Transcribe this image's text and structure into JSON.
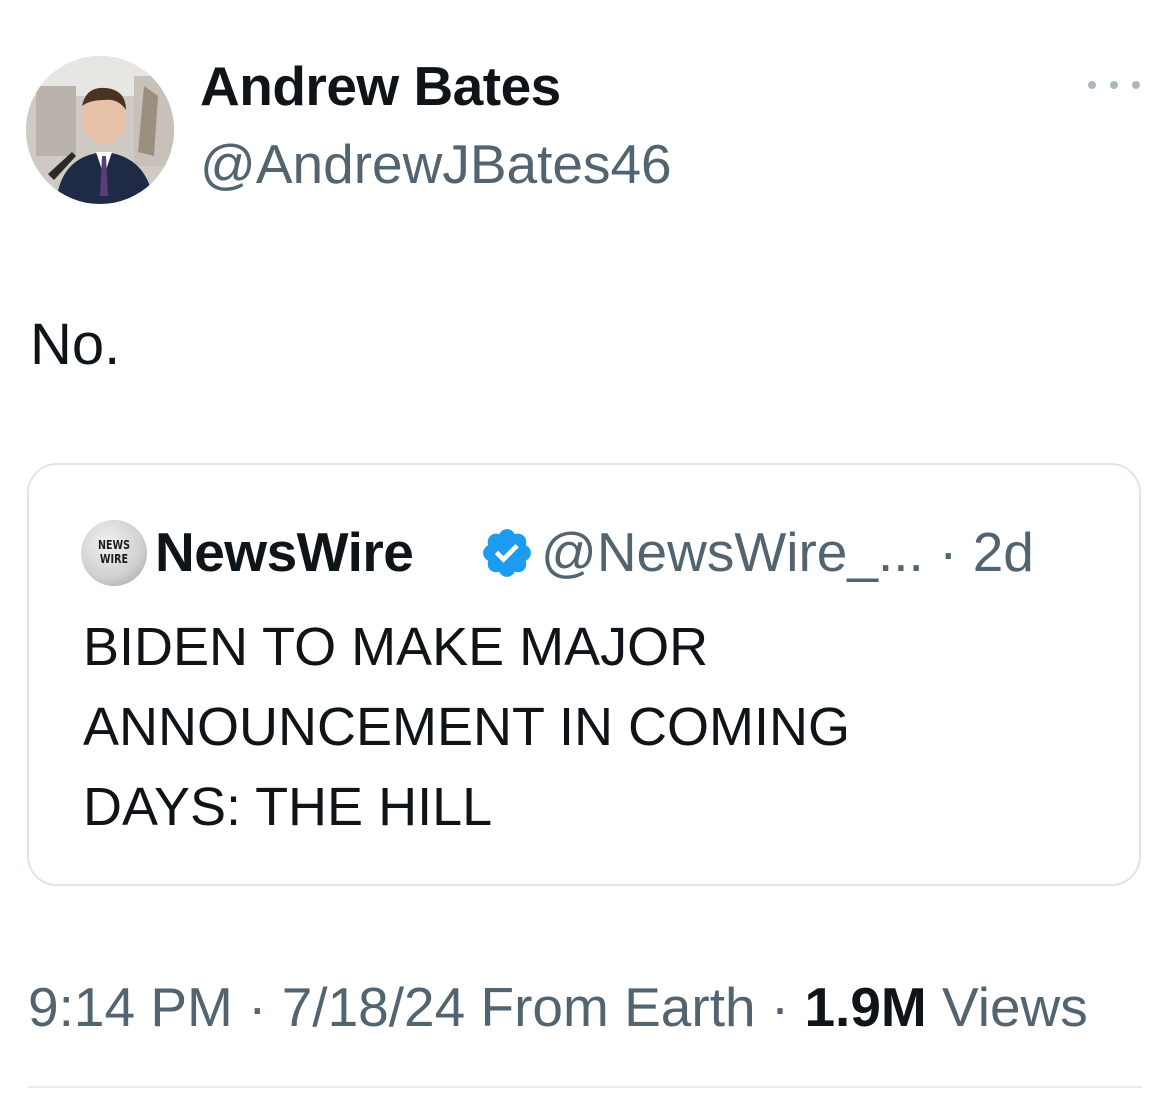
{
  "author": {
    "display_name": "Andrew Bates",
    "handle": "@AndrewJBates46",
    "avatar_icon": "profile-photo"
  },
  "more_icon": "more-horizontal-icon",
  "tweet": {
    "text": "No."
  },
  "quote": {
    "display_name": "NewsWire",
    "handle": "@NewsWire_... · 2d",
    "avatar_line1": "NEWS",
    "avatar_line2": "WIRE",
    "verified_icon": "verified-badge-icon",
    "verified_color": "#1d9bf0",
    "text": "BIDEN TO MAKE MAJOR\nANNOUNCEMENT IN COMING\nDAYS: THE HILL"
  },
  "meta": {
    "time": "9:14 PM",
    "date": "7/18/24",
    "source": "From Earth",
    "views_count": "1.9M",
    "views_label": "Views"
  },
  "colors": {
    "primary_text": "#0f1419",
    "secondary_text": "#536471",
    "border": "#dfe5ea"
  }
}
